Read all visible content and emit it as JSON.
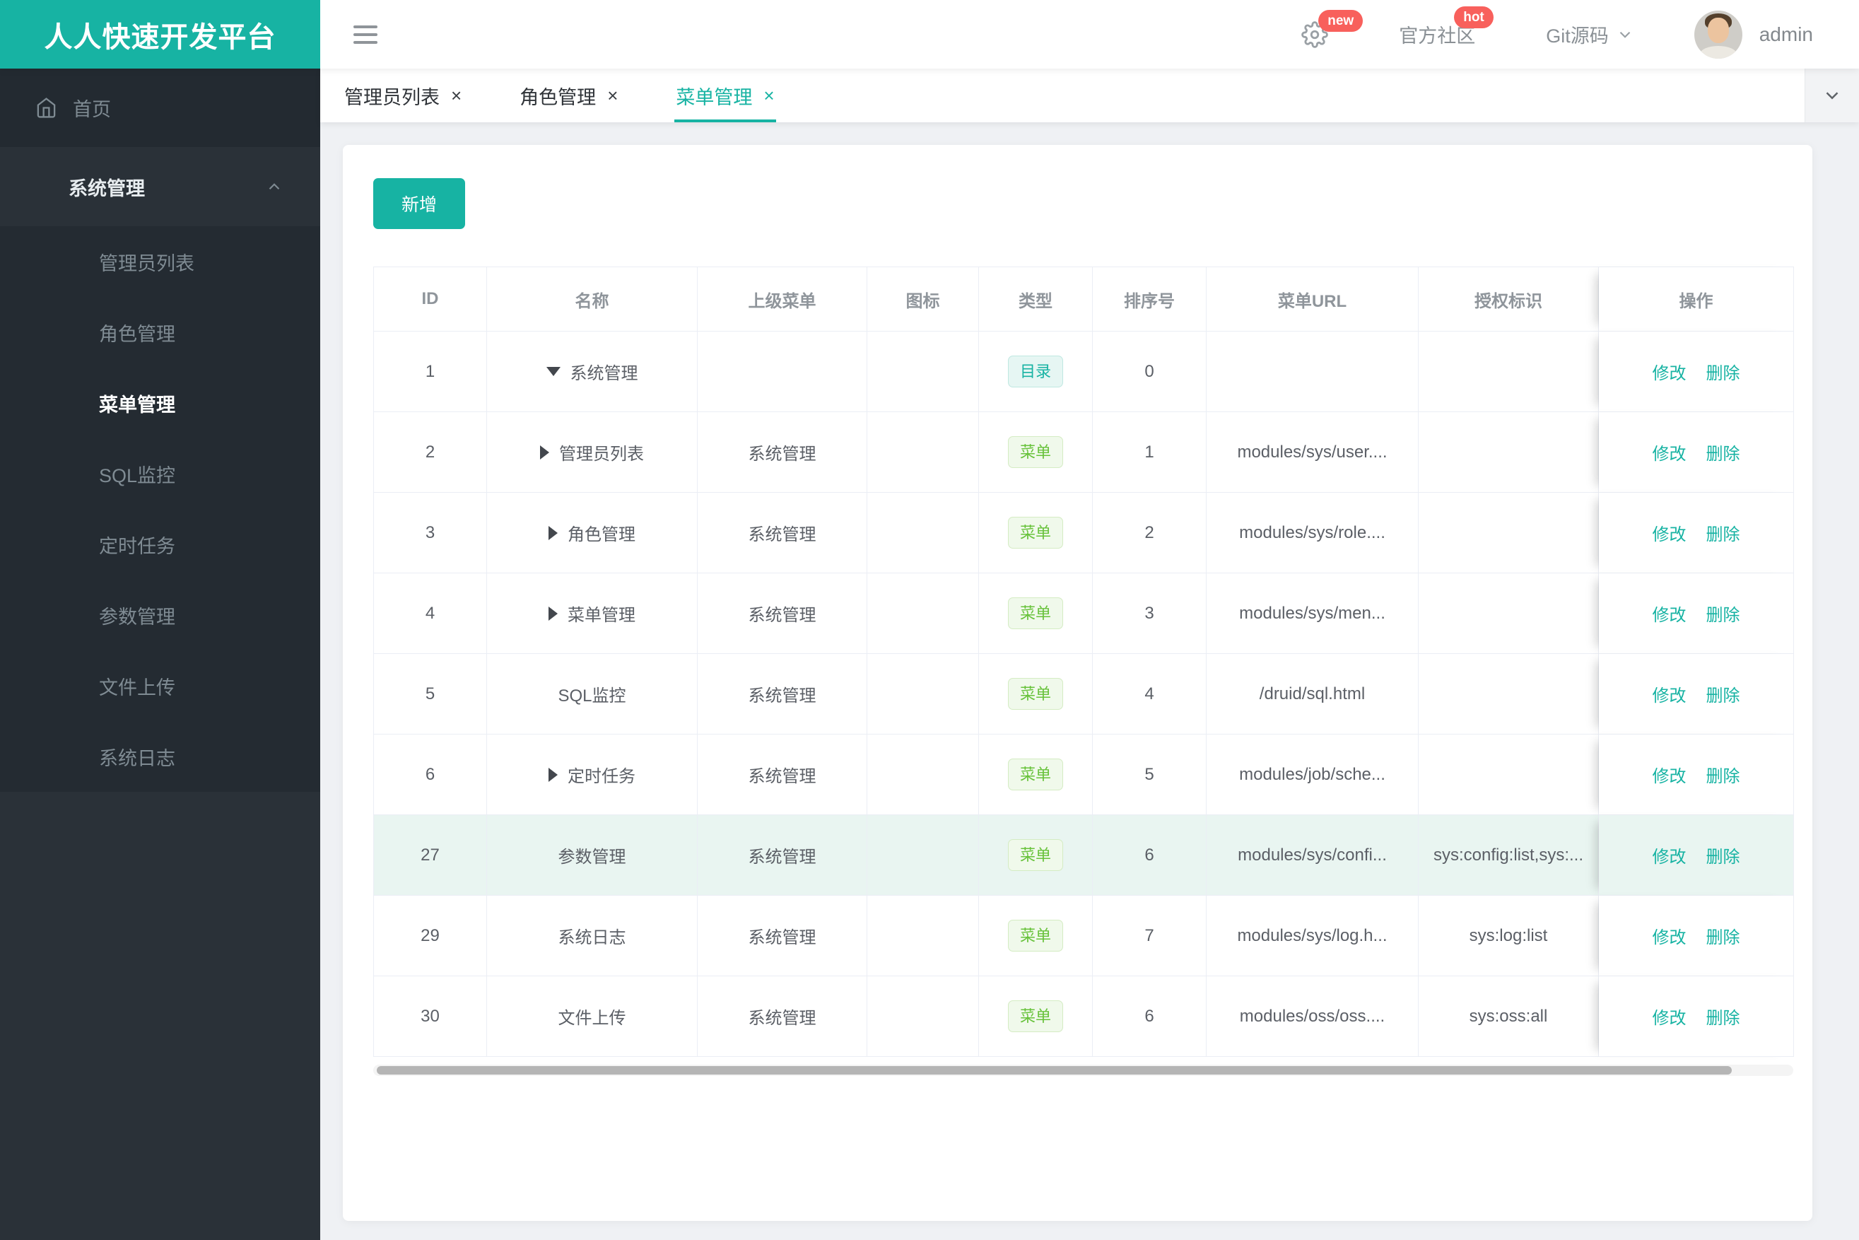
{
  "theme": {
    "primary": "#17b3a3",
    "success": "#67c23a",
    "badge_red": "#f8605c",
    "sidebar_bg": "#2a3138",
    "sidebar_dark": "#242b32",
    "highlight_row": "#e9f5f1"
  },
  "ui": {
    "close_glyph": "×"
  },
  "header": {
    "logo": "人人快速开发平台",
    "gear_badge": "new",
    "community": {
      "label": "官方社区",
      "badge": "hot"
    },
    "git": {
      "label": "Git源码"
    },
    "user": {
      "name": "admin"
    }
  },
  "sidebar": {
    "home": {
      "label": "首页"
    },
    "group": {
      "label": "系统管理",
      "expanded": true,
      "items": [
        {
          "label": "管理员列表",
          "active": false
        },
        {
          "label": "角色管理",
          "active": false
        },
        {
          "label": "菜单管理",
          "active": true
        },
        {
          "label": "SQL监控",
          "active": false
        },
        {
          "label": "定时任务",
          "active": false
        },
        {
          "label": "参数管理",
          "active": false
        },
        {
          "label": "文件上传",
          "active": false
        },
        {
          "label": "系统日志",
          "active": false
        }
      ]
    }
  },
  "tabs": [
    {
      "label": "管理员列表",
      "active": false
    },
    {
      "label": "角色管理",
      "active": false
    },
    {
      "label": "菜单管理",
      "active": true
    }
  ],
  "toolbar": {
    "add_label": "新增"
  },
  "table": {
    "columns": [
      "ID",
      "名称",
      "上级菜单",
      "图标",
      "类型",
      "排序号",
      "菜单URL",
      "授权标识",
      "操作"
    ],
    "action_labels": [
      "修改",
      "删除"
    ],
    "rows": [
      {
        "id": "1",
        "caret": "down",
        "name": "系统管理",
        "parent": "",
        "type": "目录",
        "type_variant": "primary",
        "sort": "0",
        "url": "",
        "auth": "",
        "highlighted": false
      },
      {
        "id": "2",
        "caret": "right",
        "name": "管理员列表",
        "parent": "系统管理",
        "type": "菜单",
        "type_variant": "success",
        "sort": "1",
        "url": "modules/sys/user....",
        "auth": "",
        "highlighted": false
      },
      {
        "id": "3",
        "caret": "right",
        "name": "角色管理",
        "parent": "系统管理",
        "type": "菜单",
        "type_variant": "success",
        "sort": "2",
        "url": "modules/sys/role....",
        "auth": "",
        "highlighted": false
      },
      {
        "id": "4",
        "caret": "right",
        "name": "菜单管理",
        "parent": "系统管理",
        "type": "菜单",
        "type_variant": "success",
        "sort": "3",
        "url": "modules/sys/men...",
        "auth": "",
        "highlighted": false
      },
      {
        "id": "5",
        "caret": null,
        "name": "SQL监控",
        "parent": "系统管理",
        "type": "菜单",
        "type_variant": "success",
        "sort": "4",
        "url": "/druid/sql.html",
        "auth": "",
        "highlighted": false
      },
      {
        "id": "6",
        "caret": "right",
        "name": "定时任务",
        "parent": "系统管理",
        "type": "菜单",
        "type_variant": "success",
        "sort": "5",
        "url": "modules/job/sche...",
        "auth": "",
        "highlighted": false
      },
      {
        "id": "27",
        "caret": null,
        "name": "参数管理",
        "parent": "系统管理",
        "type": "菜单",
        "type_variant": "success",
        "sort": "6",
        "url": "modules/sys/confi...",
        "auth": "sys:config:list,sys:...",
        "highlighted": true
      },
      {
        "id": "29",
        "caret": null,
        "name": "系统日志",
        "parent": "系统管理",
        "type": "菜单",
        "type_variant": "success",
        "sort": "7",
        "url": "modules/sys/log.h...",
        "auth": "sys:log:list",
        "highlighted": false
      },
      {
        "id": "30",
        "caret": null,
        "name": "文件上传",
        "parent": "系统管理",
        "type": "菜单",
        "type_variant": "success",
        "sort": "6",
        "url": "modules/oss/oss....",
        "auth": "sys:oss:all",
        "highlighted": false
      }
    ]
  }
}
